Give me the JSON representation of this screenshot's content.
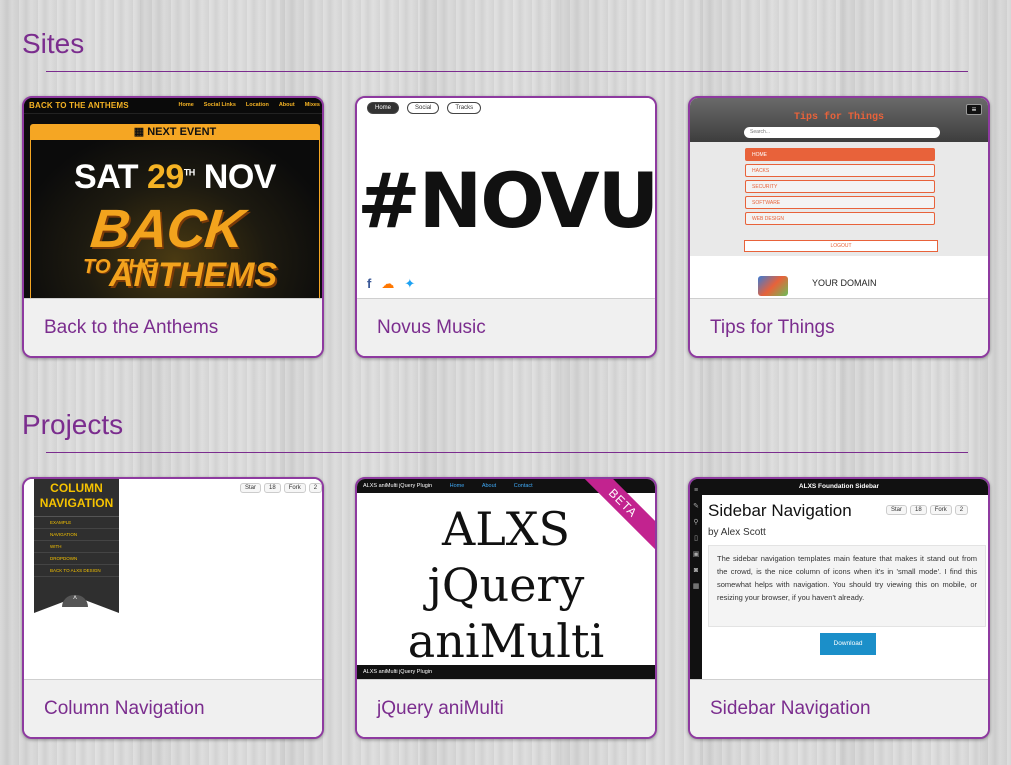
{
  "sections": {
    "sites_title": "Sites",
    "projects_title": "Projects"
  },
  "sites": [
    {
      "caption": "Back to the Anthems",
      "thumb": {
        "logo": "BACK TO THE ANTHEMS",
        "nav": [
          "Home",
          "Social Links",
          "Location",
          "About",
          "Mixes"
        ],
        "next_event": "NEXT EVENT",
        "date_day": "SAT",
        "date_num": "29",
        "date_sup": "TH",
        "date_month": "NOV",
        "poster_main": "BACK",
        "poster_to": "TO THE",
        "poster_anthems": "ANTHEMS"
      }
    },
    {
      "caption": "Novus Music",
      "thumb": {
        "pills": [
          "Home",
          "Social",
          "Tracks"
        ],
        "brand": "#NOVUS"
      }
    },
    {
      "caption": "Tips for Things",
      "thumb": {
        "title": "Tips for Things",
        "search_placeholder": "Search...",
        "menu": [
          "HOME",
          "HACKS",
          "SECURITY",
          "SOFTWARE",
          "WEB DESIGN"
        ],
        "logout": "LOGOUT",
        "domain": "YOUR DOMAIN"
      }
    }
  ],
  "projects": [
    {
      "caption": "Column Navigation",
      "thumb": {
        "panel_title": "COLUMN NAVIGATION",
        "items": [
          "EXAMPLE",
          "NAVIGATION",
          "WITH",
          "DROPDOWN",
          "BACK TO ALXS DESIGN"
        ],
        "star": "Star",
        "star_count": "18",
        "fork": "Fork",
        "fork_count": "2"
      }
    },
    {
      "caption": "jQuery aniMulti",
      "thumb": {
        "top_title": "ALXS aniMulti jQuery Plugin",
        "links": [
          "Home",
          "About",
          "Contact"
        ],
        "line1": "ALXS",
        "line2": "jQuery",
        "line3": "aniMulti",
        "footer": "ALXS aniMulti jQuery Plugin",
        "ribbon": "BETA"
      }
    },
    {
      "caption": "Sidebar Navigation",
      "thumb": {
        "bar_title": "ALXS Foundation Sidebar",
        "title": "Sidebar Navigation",
        "byline": "by Alex Scott",
        "star": "Star",
        "star_count": "18",
        "fork": "Fork",
        "fork_count": "2",
        "description": "The sidebar navigation templates main feature that makes it stand out from the crowd, is the nice column of icons when it's in 'small mode'. I find this somewhat helps with navigation. You should try viewing this on mobile, or resizing your browser, if you haven't already.",
        "download": "Download"
      }
    }
  ],
  "colors": {
    "accent": "#7b2d8e",
    "card_border": "#8e3aa0",
    "anthems_gold": "#f5b324",
    "tips_orange": "#e8623a",
    "beta_pink": "#c2238f",
    "download_blue": "#1b8fc9"
  }
}
